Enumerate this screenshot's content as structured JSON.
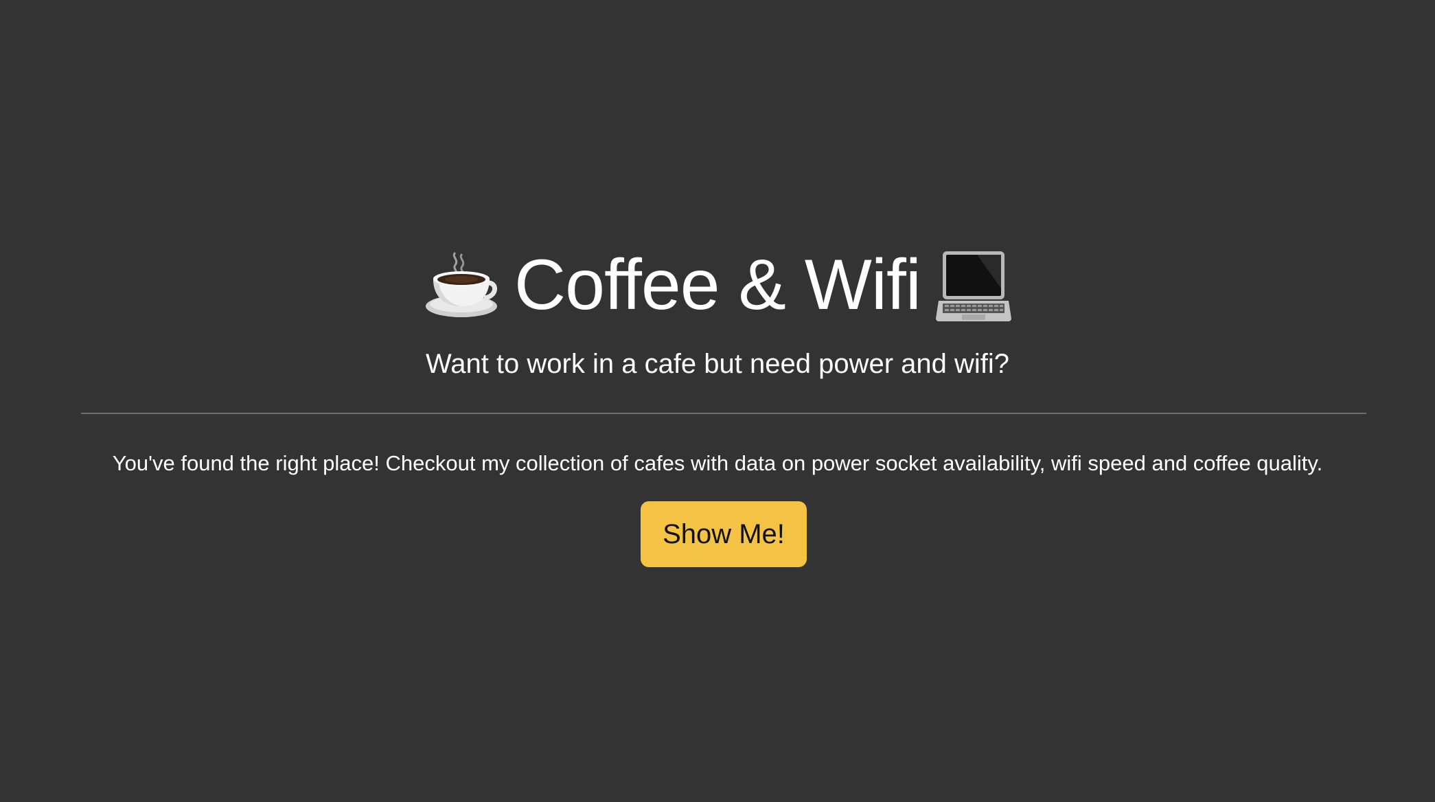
{
  "hero": {
    "title": "Coffee & Wifi",
    "title_left_icon": "coffee-cup-icon",
    "title_right_icon": "laptop-icon",
    "lead": "Want to work in a cafe but need power and wifi?"
  },
  "content": {
    "body": "You've found the right place! Checkout my collection of cafes with data on power socket availability, wifi speed and coffee quality.",
    "cta_label": "Show Me!"
  },
  "colors": {
    "background": "#333333",
    "text": "#ffffff",
    "button": "#f5c343",
    "divider": "#6f6f6f"
  }
}
